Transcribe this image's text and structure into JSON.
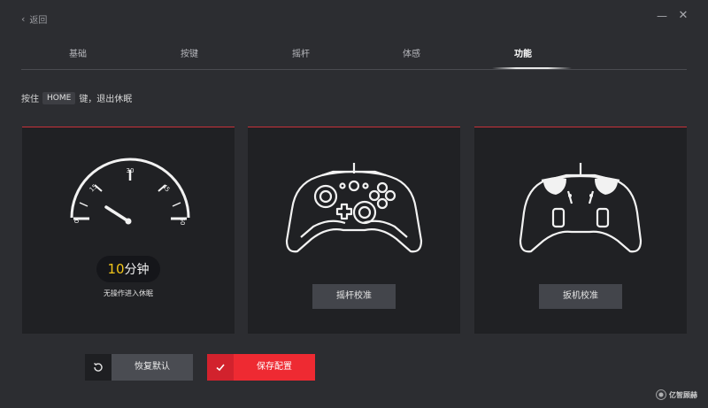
{
  "nav": {
    "back_label": "返回"
  },
  "tabs": [
    {
      "label": "基础"
    },
    {
      "label": "按键"
    },
    {
      "label": "摇杆"
    },
    {
      "label": "体感"
    },
    {
      "label": "功能"
    }
  ],
  "active_tab": "功能",
  "hint": {
    "prefix": "按住",
    "key": "HOME",
    "suffix": "键，退出休眠"
  },
  "sleep_card": {
    "dial_ticks": [
      "0",
      "15",
      "30",
      "45",
      "60"
    ],
    "minutes": "10",
    "unit": "分钟",
    "label": "无操作进入休眠"
  },
  "stick_card": {
    "button_label": "摇杆校准"
  },
  "trigger_card": {
    "button_label": "扳机校准"
  },
  "actions": {
    "restore_label": "恢复默认",
    "save_label": "保存配置"
  },
  "watermark": {
    "text": "亿智顾赫"
  },
  "colors": {
    "accent": "#ee2a32",
    "highlight": "#f0c419",
    "background": "#2c2d31",
    "card": "#202124"
  },
  "icons": {
    "back": "chevron-left-icon",
    "minimize": "minimize-icon",
    "close": "close-icon",
    "restore": "rotate-ccw-icon",
    "save": "check-icon"
  }
}
